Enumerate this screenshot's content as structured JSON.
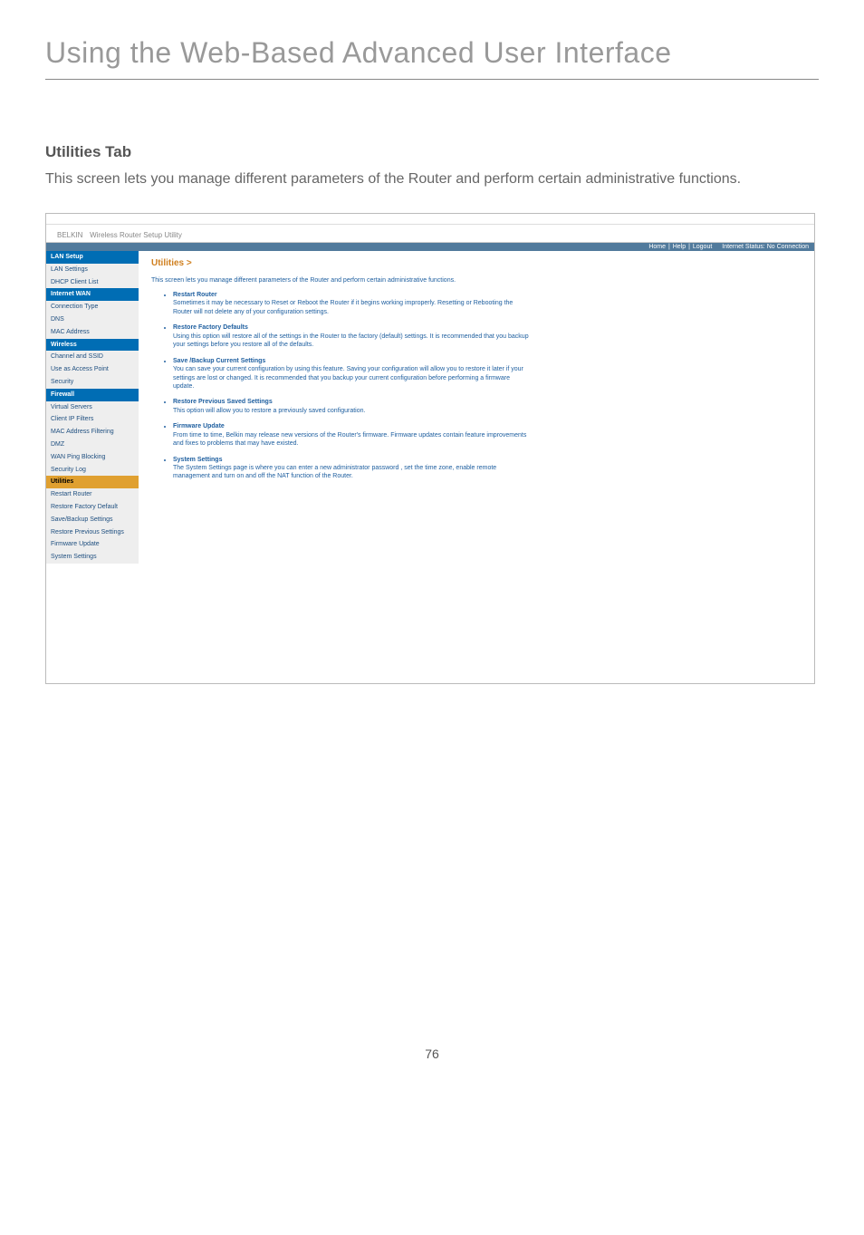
{
  "page_title": "Using the Web-Based Advanced User Interface",
  "section_title": "Utilities Tab",
  "section_desc": "This screen lets you manage different parameters of the Router and perform certain administrative functions.",
  "page_number": "76",
  "screenshot": {
    "brand": "BELKIN",
    "brand_sub": "Wireless Router Setup Utility",
    "statusbar": {
      "links": [
        "Home",
        "Help",
        "Logout"
      ],
      "status_label": "Internet Status:",
      "status_value": "No Connection"
    },
    "sidebar": [
      {
        "label": "LAN Setup",
        "class": "header"
      },
      {
        "label": "LAN Settings"
      },
      {
        "label": "DHCP Client List"
      },
      {
        "label": "Internet WAN",
        "class": "header"
      },
      {
        "label": "Connection Type"
      },
      {
        "label": "DNS"
      },
      {
        "label": "MAC Address"
      },
      {
        "label": "Wireless",
        "class": "header"
      },
      {
        "label": "Channel and SSID"
      },
      {
        "label": "Use as Access Point"
      },
      {
        "label": "Security"
      },
      {
        "label": "Firewall",
        "class": "header"
      },
      {
        "label": "Virtual Servers"
      },
      {
        "label": "Client IP Filters"
      },
      {
        "label": "MAC Address Filtering"
      },
      {
        "label": "DMZ"
      },
      {
        "label": "WAN Ping Blocking"
      },
      {
        "label": "Security Log"
      },
      {
        "label": "Utilities",
        "class": "selected"
      },
      {
        "label": "Restart Router"
      },
      {
        "label": "Restore Factory Default"
      },
      {
        "label": "Save/Backup Settings"
      },
      {
        "label": "Restore Previous Settings"
      },
      {
        "label": "Firmware Update"
      },
      {
        "label": "System Settings"
      }
    ],
    "main": {
      "title": "Utilities >",
      "desc": "This screen lets you manage different parameters of the Router and perform certain administrative functions.",
      "items": [
        {
          "title": "Restart Router",
          "desc": "Sometimes it may be necessary to Reset or Reboot the Router if it begins working improperly. Resetting or Rebooting the Router will not delete any of your configuration settings."
        },
        {
          "title": "Restore Factory Defaults",
          "desc": "Using this option will restore all of the settings in the Router to the factory (default) settings. It is recommended that you backup your settings before you restore all of the defaults."
        },
        {
          "title": "Save /Backup Current Settings",
          "desc": "You can save your current configuration by using this feature. Saving your configuration will allow you to restore it later if your settings are lost or changed. It is recommended that you backup your current configuration before performing a firmware update."
        },
        {
          "title": "Restore Previous Saved Settings",
          "desc": "This option will allow you to restore a previously saved configuration."
        },
        {
          "title": "Firmware Update",
          "desc": "From time to time, Belkin may release new versions of the Router's firmware. Firmware updates contain feature improvements and fixes to problems that may have existed."
        },
        {
          "title": "System Settings",
          "desc": "The System Settings page is where you can enter a new administrator password , set the time zone, enable remote management and turn on and off the NAT function of the Router."
        }
      ]
    }
  }
}
